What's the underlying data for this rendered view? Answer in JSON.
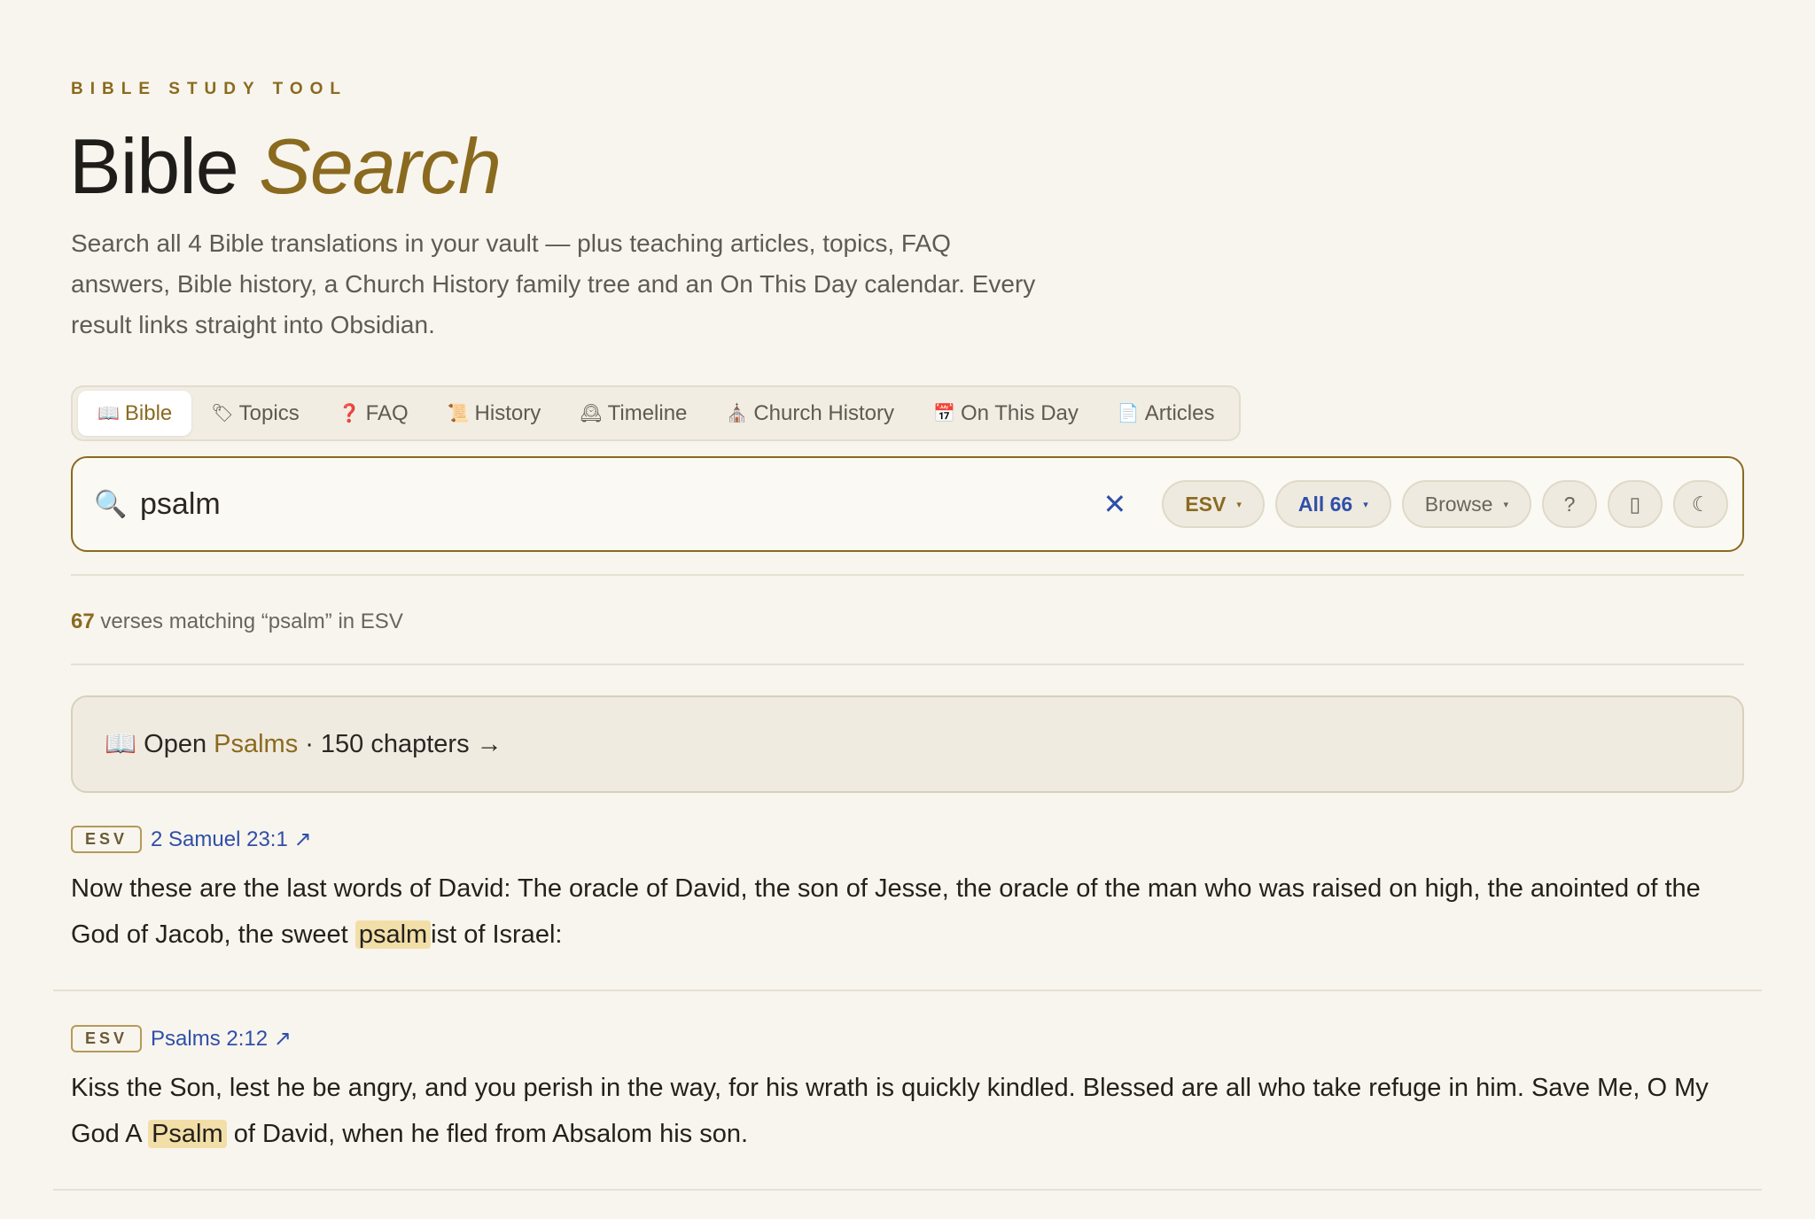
{
  "header": {
    "eyebrow": "BIBLE STUDY TOOL",
    "title_plain": "Bible",
    "title_accent": "Search",
    "subtitle": "Search all 4 Bible translations in your vault — plus teaching articles, topics, FAQ answers, Bible history, a Church History family tree and an On This Day calendar. Every result links straight into Obsidian."
  },
  "tabs": [
    {
      "icon": "📖",
      "label": "Bible",
      "icon_name": "open-book-icon"
    },
    {
      "icon": "🏷",
      "label": "Topics",
      "icon_name": "tag-icon"
    },
    {
      "icon": "❓",
      "label": "FAQ",
      "icon_name": "question-icon"
    },
    {
      "icon": "📜",
      "label": "History",
      "icon_name": "scroll-icon"
    },
    {
      "icon": "🕰",
      "label": "Timeline",
      "icon_name": "clock-icon"
    },
    {
      "icon": "⛪",
      "label": "Church History",
      "icon_name": "church-icon"
    },
    {
      "icon": "📅",
      "label": "On This Day",
      "icon_name": "calendar-icon"
    },
    {
      "icon": "📄",
      "label": "Articles",
      "icon_name": "document-icon"
    }
  ],
  "search": {
    "value": "psalm",
    "clear_icon": "✕",
    "translation": "ESV",
    "books": "All 66",
    "browse": "Browse",
    "help": "?",
    "bookmark": "▯",
    "theme": "☾"
  },
  "results": {
    "count": "67",
    "summary": " verses matching “psalm” in ESV",
    "open_prefix": "Open",
    "open_book": "Psalms",
    "open_suffix": "· 150 chapters →"
  },
  "verses": [
    {
      "badge": "ESV",
      "ref": "2 Samuel 23:1 ↗",
      "before": "Now these are the last words of David: The oracle of David, the son of Jesse, the oracle of the man who was raised on high, the anointed of the God of Jacob, the sweet ",
      "match": "psalm",
      "after": "ist of Israel:"
    },
    {
      "badge": "ESV",
      "ref": "Psalms 2:12 ↗",
      "before": "Kiss the Son, lest he be angry, and you perish in the way, for his wrath is quickly kindled. Blessed are all who take refuge in him. Save Me, O My God A ",
      "match": "Psalm",
      "after": " of David, when he fled from Absalom his son."
    }
  ],
  "colors": {
    "accent": "#8a6a1f",
    "link": "#2f4fa8",
    "background": "#f8f5ee",
    "highlight": "#f2dfa8"
  }
}
